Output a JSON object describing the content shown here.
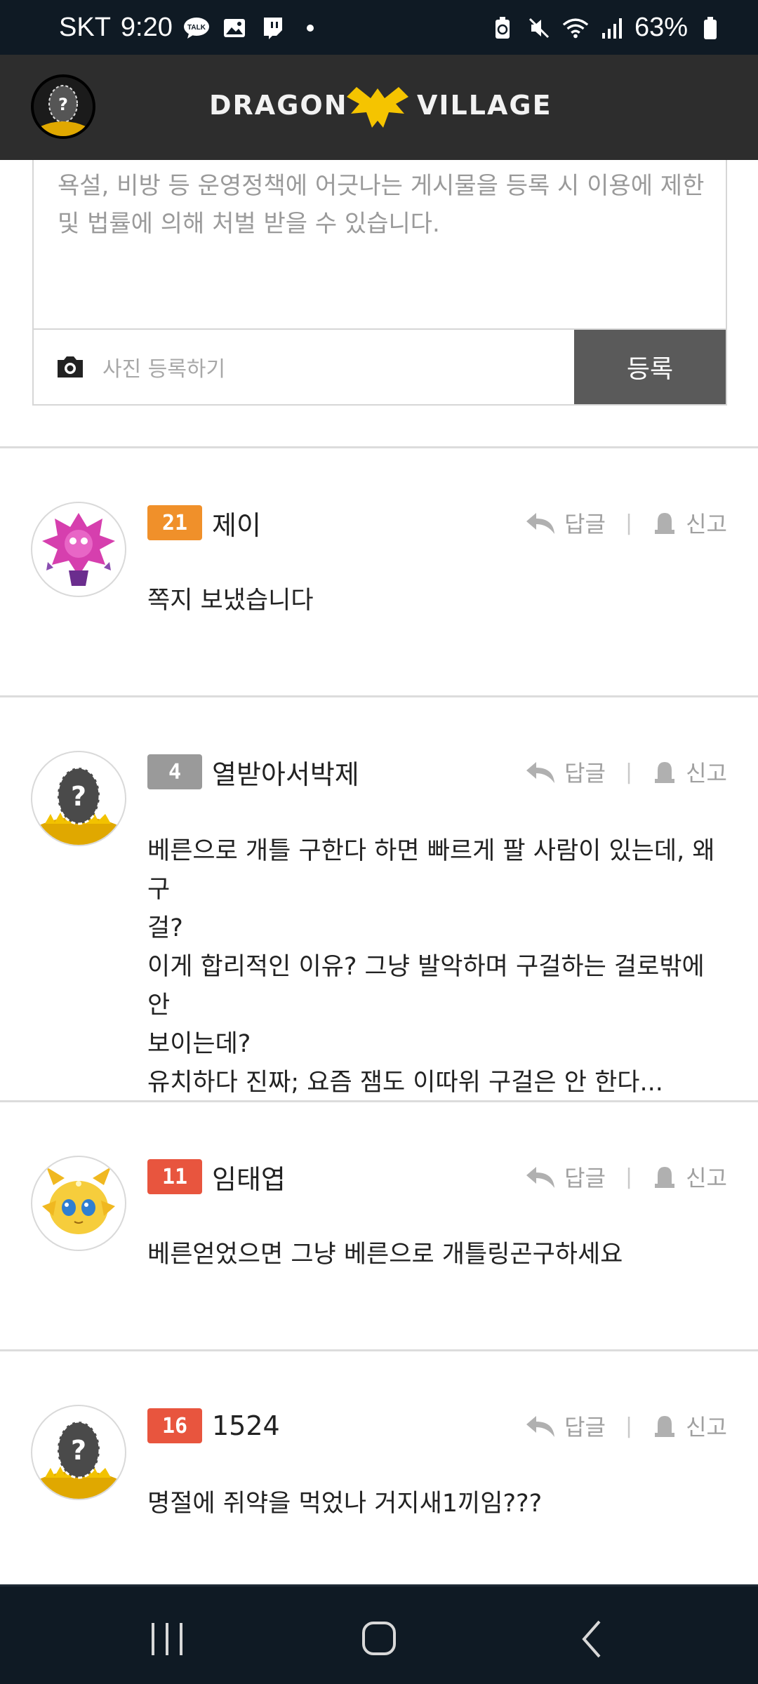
{
  "status": {
    "carrier": "SKT",
    "time": "9:20",
    "battery": "63%",
    "left_icons": [
      "kakaotalk-icon",
      "gallery-icon",
      "twitch-icon",
      "dot-icon"
    ],
    "right_icons": [
      "battery-saver-icon",
      "mute-icon",
      "wifi-icon",
      "signal-icon",
      "battery-icon"
    ]
  },
  "header": {
    "logo_left": "DRAGON",
    "logo_right": "VILLAGE",
    "colors": {
      "background": "#2d2d2d",
      "logo_accent": "#f5c400"
    }
  },
  "composer": {
    "placeholder": "욕설, 비방 등 운영정책에 어긋나는 게시물을 등록 시 이용에 제한 및 법률에 의해 처벌 받을 수 있습니다.",
    "photo_label": "사진 등록하기",
    "submit_label": "등록"
  },
  "actions": {
    "reply": "답글",
    "report": "신고"
  },
  "comments": [
    {
      "level": "21",
      "level_color": "#f0902a",
      "username": "제이",
      "avatar": "purple-dragon",
      "lines": [
        "쪽지 보냈습니다"
      ]
    },
    {
      "level": "4",
      "level_color": "#9a9a9a",
      "username": "열받아서박제",
      "avatar": "unknown-egg",
      "lines": [
        "베른으로 개틀 구한다 하면 빠르게 팔 사람이 있는데, 왜 구",
        "걸?",
        "이게 합리적인 이유? 그냥 발악하며 구걸하는 걸로밖에 안",
        "보이는데?",
        "유치하다 진짜; 요즘 잼도 이따위 구걸은 안 한다..."
      ]
    },
    {
      "level": "11",
      "level_color": "#e8553e",
      "username": "임태엽",
      "avatar": "golden-dragon",
      "lines": [
        "베른얻었으면 그냥 베른으로 개틀링곤구하세요"
      ]
    },
    {
      "level": "16",
      "level_color": "#e8553e",
      "username": "1524",
      "avatar": "unknown-egg",
      "lines": [
        "명절에 쥐약을 먹었나 거지새1끼임???"
      ]
    }
  ]
}
